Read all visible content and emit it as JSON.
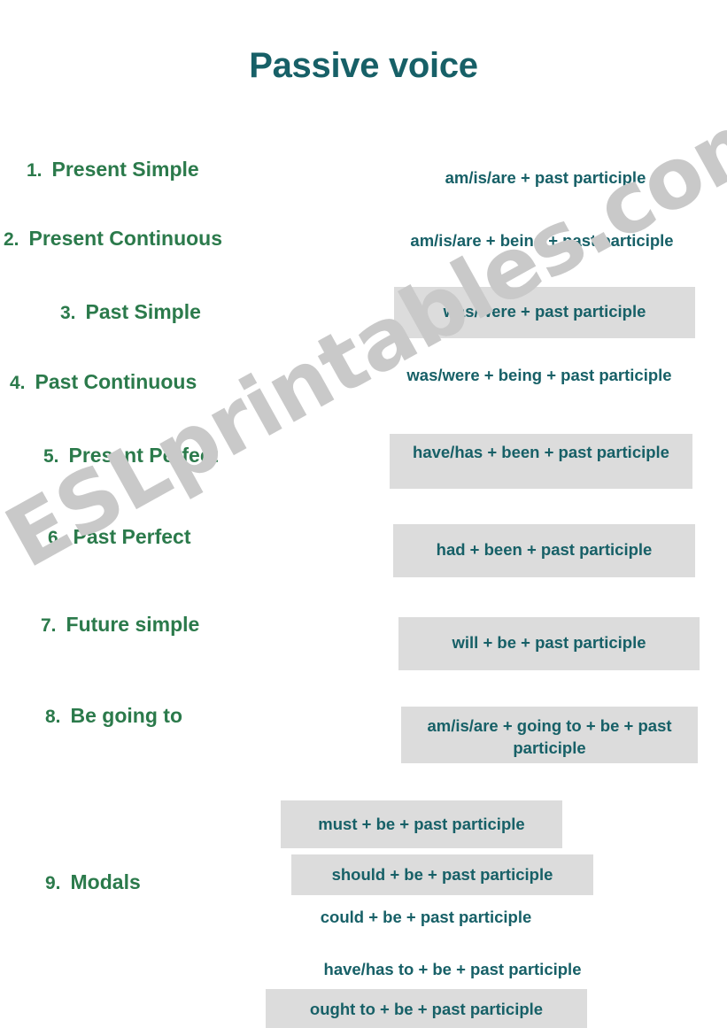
{
  "page": {
    "title": "Passive voice",
    "watermark": "ESLprintables.com",
    "colors": {
      "title": "#176067",
      "tense_label": "#2b7a4b",
      "formula": "#176067",
      "highlight_box": "#dcdcdc",
      "watermark": "#c9c9c9",
      "background": "#ffffff"
    }
  },
  "tenses": [
    {
      "number": "1.",
      "label": "Present Simple"
    },
    {
      "number": "2.",
      "label": "Present Continuous"
    },
    {
      "number": "3.",
      "label": "Past Simple"
    },
    {
      "number": "4.",
      "label": "Past Continuous"
    },
    {
      "number": "5.",
      "label": "Present Perfect"
    },
    {
      "number": "6.",
      "label": "Past Perfect"
    },
    {
      "number": "7.",
      "label": "Future simple"
    },
    {
      "number": "8.",
      "label": "Be going to"
    },
    {
      "number": "9.",
      "label": "Modals"
    }
  ],
  "formulas": [
    {
      "text": "am/is/are + past participle",
      "highlighted": false
    },
    {
      "text": "am/is/are + being + past participle",
      "highlighted": false
    },
    {
      "text": "was/were + past participle",
      "highlighted": true
    },
    {
      "text": "was/were + being + past participle",
      "highlighted": false
    },
    {
      "text": "have/has + been + past participle",
      "highlighted": true
    },
    {
      "text": "had + been + past participle",
      "highlighted": true
    },
    {
      "text": "will + be + past participle",
      "highlighted": true
    },
    {
      "text": "am/is/are + going to + be + past participle",
      "highlighted": true
    }
  ],
  "modal_formulas": [
    {
      "text": "must + be + past participle",
      "highlighted": true
    },
    {
      "text": "should + be + past participle",
      "highlighted": true
    },
    {
      "text": "could + be + past participle",
      "highlighted": false
    },
    {
      "text": "have/has to + be + past participle",
      "highlighted": false
    },
    {
      "text": "ought to + be + past participle",
      "highlighted": true
    }
  ]
}
